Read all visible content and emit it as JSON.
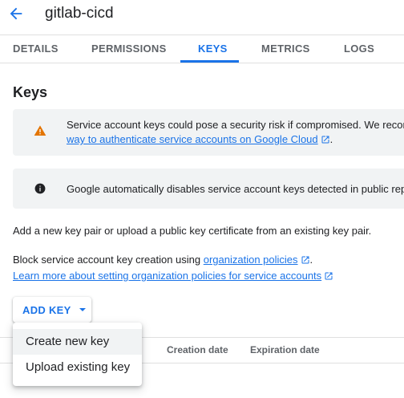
{
  "header": {
    "title": "gitlab-cicd"
  },
  "tabs": [
    {
      "label": "DETAILS"
    },
    {
      "label": "PERMISSIONS"
    },
    {
      "label": "KEYS"
    },
    {
      "label": "METRICS"
    },
    {
      "label": "LOGS"
    }
  ],
  "active_tab": "KEYS",
  "keys": {
    "title": "Keys",
    "warning": {
      "icon": "warning-icon",
      "line1": "Service account keys could pose a security risk if compromised. We recom",
      "link": "way to authenticate service accounts on Google Cloud",
      "tail": "."
    },
    "info": {
      "icon": "info-icon",
      "text": "Google automatically disables service account keys detected in public rep"
    },
    "description": "Add a new key pair or upload a public key certificate from an existing key pair.",
    "policy_prefix": "Block service account key creation using ",
    "policy_link": "organization policies",
    "policy_suffix": ".",
    "learn_more_link": "Learn more about setting organization policies for service accounts",
    "add_key_label": "ADD KEY",
    "menu": {
      "items": [
        {
          "label": "Create new key"
        },
        {
          "label": "Upload existing key"
        }
      ]
    },
    "table": {
      "columns": [
        "Creation date",
        "Expiration date"
      ]
    }
  },
  "colors": {
    "accent": "#1a73e8",
    "warning": "#e37400",
    "banner_bg": "#f1f3f4"
  }
}
